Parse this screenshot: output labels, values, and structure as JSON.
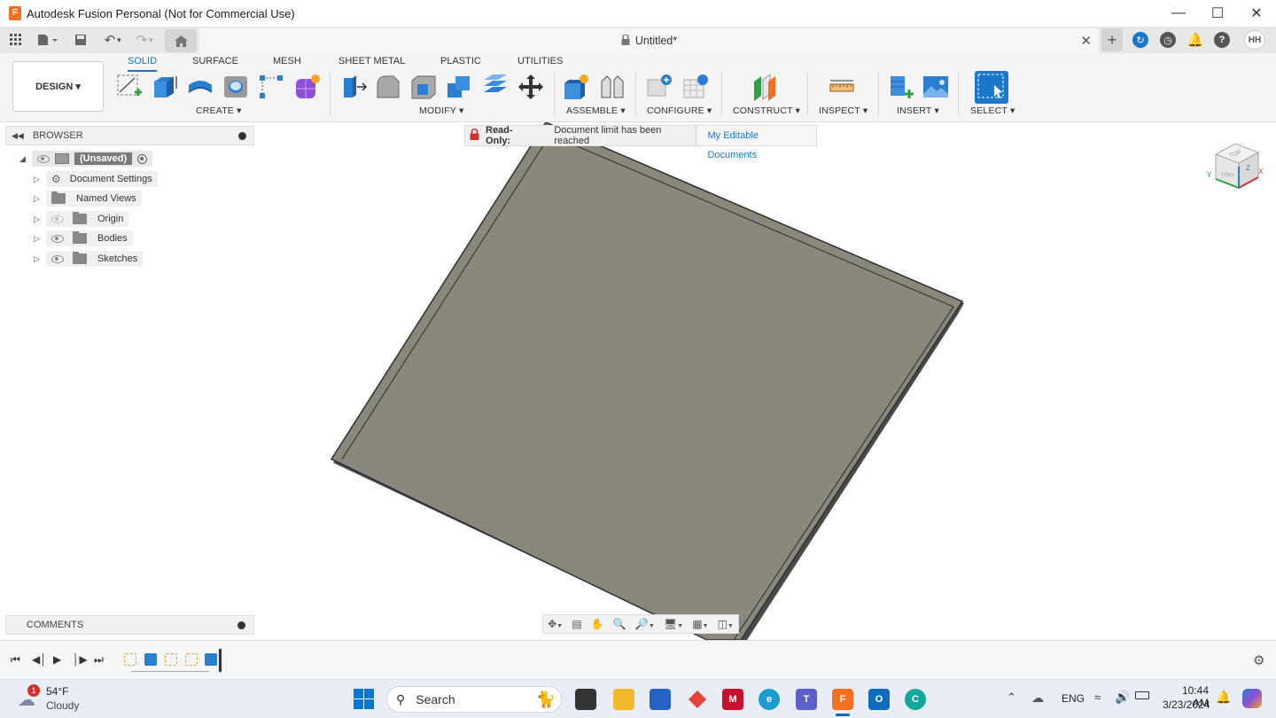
{
  "window": {
    "title": "Autodesk Fusion Personal (Not for Commercial Use)"
  },
  "document_tab": {
    "title": "Untitled*"
  },
  "user": {
    "initials": "HH"
  },
  "workspace": {
    "label": "DESIGN ▾"
  },
  "toolbar": {
    "tabs": [
      "SOLID",
      "SURFACE",
      "MESH",
      "SHEET METAL",
      "PLASTIC",
      "UTILITIES"
    ],
    "groups": {
      "create": "CREATE ▾",
      "modify": "MODIFY ▾",
      "assemble": "ASSEMBLE ▾",
      "configure": "CONFIGURE ▾",
      "construct": "CONSTRUCT ▾",
      "inspect": "INSPECT ▾",
      "insert": "INSERT ▾",
      "select": "SELECT ▾"
    }
  },
  "browser": {
    "title": "BROWSER",
    "root": "(Unsaved)",
    "items": [
      {
        "label": "Document Settings",
        "icon": "gear-icon",
        "visibility": "none"
      },
      {
        "label": "Named Views",
        "icon": "folder-icon",
        "visibility": "none"
      },
      {
        "label": "Origin",
        "icon": "folder-icon",
        "visibility": "hidden"
      },
      {
        "label": "Bodies",
        "icon": "folder-icon",
        "visibility": "visible"
      },
      {
        "label": "Sketches",
        "icon": "folder-icon",
        "visibility": "visible"
      }
    ]
  },
  "comments": {
    "title": "COMMENTS"
  },
  "banner": {
    "prefix": "Read-Only:",
    "message": "Document limit has been reached",
    "link": "My Editable Documents"
  },
  "viewcube": {
    "top": "TOP",
    "left": "LEFT",
    "axis_x": "X",
    "axis_y": "Y",
    "axis_z": "Z"
  },
  "taskbar": {
    "weather_temp": "54°F",
    "weather_desc": "Cloudy",
    "weather_badge": "1",
    "search_placeholder": "Search",
    "language": "ENG",
    "time": "10:44 AM",
    "date": "3/23/2024"
  },
  "colors": {
    "accent": "#1a77c9",
    "fusion_orange": "#f37021",
    "plate": "#8a877d",
    "plate_edge": "#3a3a38"
  }
}
